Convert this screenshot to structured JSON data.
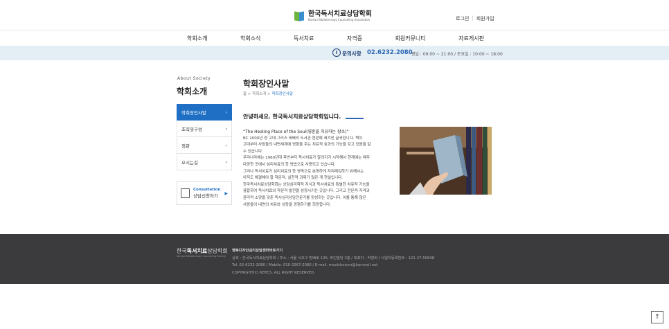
{
  "header": {
    "logo_ko": "한국독서치료상담학회",
    "logo_en": "Korean Bibliotherapy Counseling Association",
    "login": "로그인",
    "join": "회원가입"
  },
  "nav": [
    "학회소개",
    "학회소식",
    "독서치료",
    "자격증",
    "회원커뮤니티",
    "자료게시판"
  ],
  "info_bar": {
    "icon": "i",
    "label": "문의사항",
    "phone": "02.6232.2080",
    "hours": "· 평일 : 09:00 ~ 21:00 / 토요일 : 10:00 ~ 18:00"
  },
  "sidebar": {
    "en_title": "About Society",
    "title": "학회소개",
    "items": [
      "학회장인사말",
      "조직및구성",
      "정관",
      "오시는길"
    ],
    "consult_en": "Consultation",
    "consult_ko": "상담신청하기"
  },
  "main": {
    "title": "학회장인사말",
    "crumb_home": "홈",
    "crumb_mid": "학회소개",
    "crumb_cur": "학회장인사말",
    "greeting": "안녕하세요. 한국독서치료상담학회입니다.",
    "lead": "“The Healing Place of the Soul(영혼을 치유하는 장소)”",
    "lines": [
      "BC 1000년 경 고대 그리스 테베의 도서관 현판에 새겨진 글귀입니다. 책이",
      "고대부터 사람들의 내면세계에 영향을 주는 치료적 효과의 기능을 갖고 있음을 알",
      "수 있습니다.",
      "우리나라에는 1960년대 후반부터 독서치료가 알려지기 시작해서 현재에는 매우",
      "다양한 곳에서 심리치료의 한 방법으로 사용되고 있습니다.",
      "그러나 독서치료가 심리치료의 한 영역으로 분명하게 자리매김하기 위해서는",
      "아직도 해결해야 할 학문적, 실천적 과제가 많은 게 현실입니다.",
      "한국독서치료상담학회는 상담심리학적 지식과 독서치료의 특별한 치유적 기능을",
      "융합하여 독서치료의 학문적 발전을 성장시키는 곳입니다. 그리고 전문적 자격과",
      "윤리적 소양을 갖춘 독서심리상담전문가를 양성하는 곳입니다. 이를 통해 많은",
      "사람들이 내면의 치유와 성장을 경험하기를 희망합니다."
    ]
  },
  "footer": {
    "logo_a": "한국",
    "logo_b": "독서치료",
    "logo_c": "상담학회",
    "logo_sub": "Korean Bibliotherapy Counseling Society",
    "company": "행복디자인심리상담센터바로가기",
    "address": "상호 : 한국독서치료상담학회 / 주소 : 서울 서초구 방배로 136, 화인빌딩 3층 / 대표자 : 박영희 / 사업자등록번호 : 121-37-50848",
    "contact": "Tel. 02-6232-2080 / Mobile. 010-3267-2080 / E-mail. moolchurum@hanmail.net",
    "copyright": "COPYRIGHT(C) KBTCS. ALL RIGHT RESERVED."
  },
  "to_top": "↑"
}
